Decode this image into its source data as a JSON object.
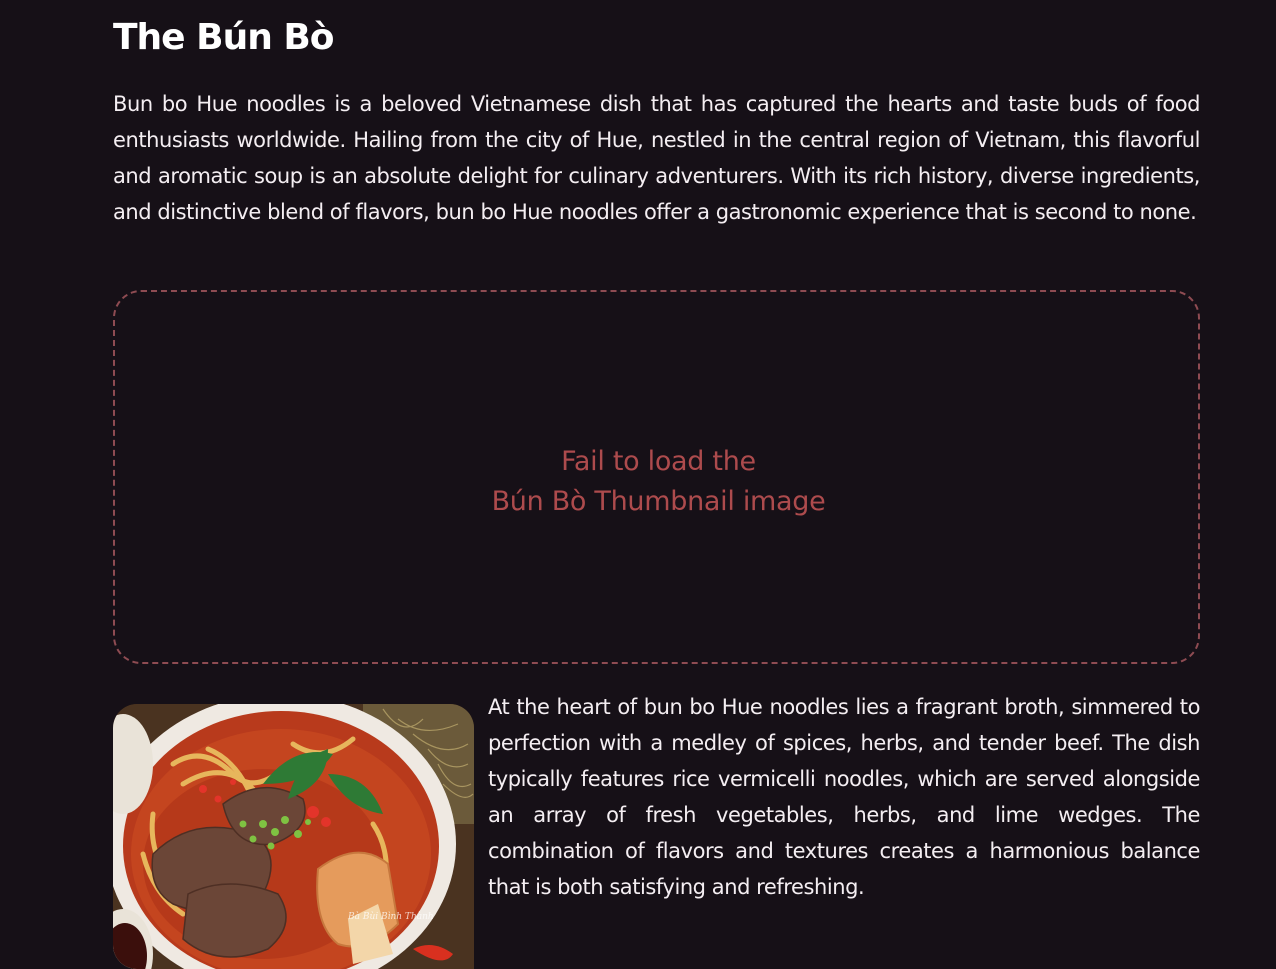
{
  "article": {
    "title": "The Bún Bò",
    "intro": "Bun bo Hue noodles is a beloved Vietnamese dish that has captured the hearts and taste buds of food enthusiasts worldwide. Hailing from the city of Hue, nestled in the central region of Vietnam, this flavorful and aromatic soup is an absolute delight for culinary adventurers. With its rich history, diverse ingredients, and distinctive blend of flavors, bun bo Hue noodles offer a gastronomic experience that is second to none.",
    "thumbnail": {
      "error_line1": "Fail to load the",
      "error_line2": "Bún Bò Thumbnail image",
      "border_color": "#8e4b52",
      "text_color": "#ad4b4d"
    },
    "photo": {
      "watermark": "Bà Bùi Bình Thành",
      "subject": "bowl of bun bo hue noodle soup"
    },
    "body": "At the heart of bun bo Hue noodles lies a fragrant broth, simmered to perfection with a medley of spices, herbs, and tender beef. The dish typically features rice vermicelli noodles, which are served alongside an array of fresh vegetables, herbs, and lime wedges. The combination of flavors and textures creates a harmonious balance that is both satisfying and refreshing."
  },
  "theme": {
    "background": "#161017",
    "text": "#f4eef2"
  }
}
